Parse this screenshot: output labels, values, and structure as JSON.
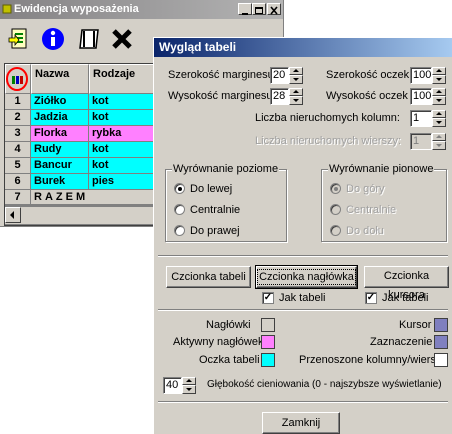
{
  "main_window": {
    "title": "Ewidencja wyposażenia",
    "grid": {
      "columns": [
        "Nazwa",
        "Rodzaje"
      ],
      "rows": [
        {
          "num": "1",
          "nazwa": "Ziółko",
          "rodzaje": "kot"
        },
        {
          "num": "2",
          "nazwa": "Jadzia",
          "rodzaje": "kot"
        },
        {
          "num": "3",
          "nazwa": "Florka",
          "rodzaje": "rybka"
        },
        {
          "num": "4",
          "nazwa": "Rudy",
          "rodzaje": "kot"
        },
        {
          "num": "5",
          "nazwa": "Bancur",
          "rodzaje": "kot"
        },
        {
          "num": "6",
          "nazwa": "Burek",
          "rodzaje": "pies"
        }
      ],
      "totals": {
        "num": "7",
        "label": "RAZEM"
      }
    }
  },
  "dialog": {
    "title": "Wygląd tabeli",
    "margin_width": {
      "label": "Szerokość marginesu",
      "value": "20"
    },
    "margin_height": {
      "label": "Wysokość marginesu",
      "value": "28"
    },
    "cell_width": {
      "label": "Szerokość oczek",
      "value": "100"
    },
    "cell_height": {
      "label": "Wysokość oczek",
      "value": "100"
    },
    "fixed_cols": {
      "label": "Liczba nieruchomych kolumn:",
      "value": "1"
    },
    "fixed_rows": {
      "label": "Liczba nieruchomych wierszy:",
      "value": "1"
    },
    "horizontal_align": {
      "title": "Wyrównanie poziome",
      "options": [
        "Do lewej",
        "Centralnie",
        "Do prawej"
      ],
      "selected": "Do lewej"
    },
    "vertical_align": {
      "title": "Wyrównanie pionowe",
      "options": [
        "Do góry",
        "Centralnie",
        "Do dołu"
      ],
      "selected": "Do góry"
    },
    "fonts": {
      "table_button": "Czcionka tabeli",
      "header_button": "Czcionka nagłówka",
      "cursor_button": "Czcionka kursora",
      "same_as_table_1": "Jak tabeli",
      "same_as_table_2": "Jak tabeli"
    },
    "colors": {
      "headers": {
        "label": "Nagłówki",
        "color": "#d4d0c8"
      },
      "active_header": {
        "label": "Aktywny nagłówek",
        "color": "#ff80ff"
      },
      "table_cells": {
        "label": "Oczka tabeli",
        "color": "#00ffff"
      },
      "cursor": {
        "label": "Kursor",
        "color": "#7f7fbf"
      },
      "selection": {
        "label": "Zaznaczenie",
        "color": "#8080c0"
      },
      "moved": {
        "label": "Przenoszone kolumny/wiersze",
        "color": "#ffffff"
      }
    },
    "shadow_depth": {
      "value": "40",
      "label": "Głębokość cieniowania (0 - najszybsze wyświetlanie)"
    },
    "close_button": "Zamknij"
  }
}
